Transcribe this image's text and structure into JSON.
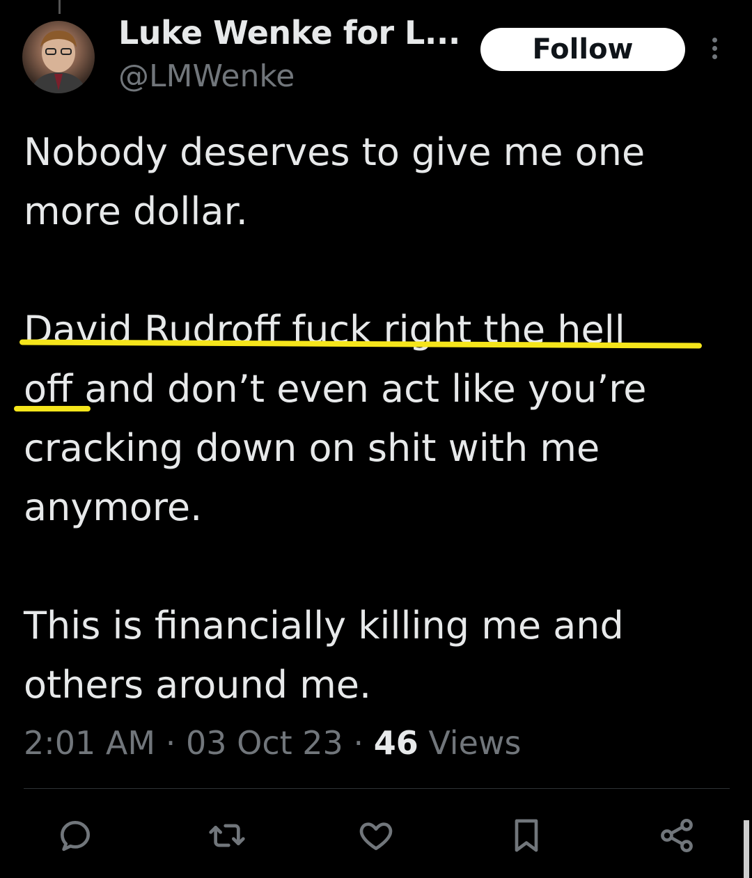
{
  "author": {
    "display_name": "Luke Wenke for L...",
    "handle": "@LMWenke"
  },
  "follow_label": "Follow",
  "tweet": {
    "paragraphs": [
      "Nobody deserves to give me one more dollar.",
      "David Rudroff fuck right the hell off and don’t even act like you’re cracking down on shit with me anymore.",
      "This is financially killing me and others around me."
    ],
    "lines": [
      "Nobody deserves to give me one",
      "more dollar.",
      "David Rudroff fuck right the hell",
      "off and don’t even act like you’re",
      "cracking down on shit with me",
      "anymore.",
      "This is financially killing me and",
      "others around me."
    ]
  },
  "meta": {
    "time": "2:01 AM",
    "separator": "·",
    "date": "03 Oct 23",
    "views_count": "46",
    "views_label": "Views"
  },
  "actions": [
    "reply-icon",
    "retweet-icon",
    "like-icon",
    "bookmark-icon",
    "share-icon"
  ],
  "colors": {
    "background": "#000000",
    "text": "#e7e9ea",
    "secondary": "#71767b",
    "highlight": "#f5e51b"
  }
}
